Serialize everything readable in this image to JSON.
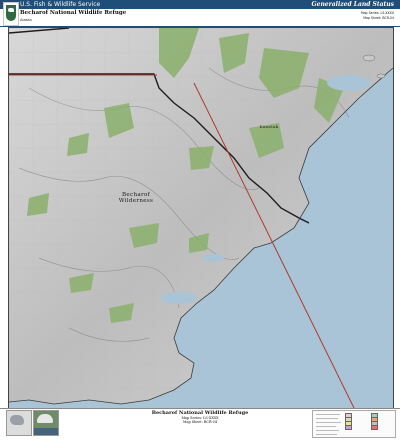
{
  "header": {
    "agency": "U.S. Fish & Wildlife Service",
    "title": "Becharof National Wildlife Refuge",
    "state": "Alaska",
    "status_title": "Generalized Land Status",
    "map_series": "Map Series: LS-XXXX",
    "map_sheet": "Map Sheet: BCR-04"
  },
  "map": {
    "labels": {
      "wilderness": "Becharof Wilderness",
      "place": "Kanatak"
    },
    "colors": {
      "refuge_land": "#8ab06c",
      "water": "#a8c4d6",
      "boundary": "#1d1d1d",
      "survey_line": "#b03a2e",
      "terrain": "#cfcfcf"
    }
  },
  "footer": {
    "title": "Becharof National Wildlife Refuge",
    "series": "Map Series: LS-XXXX",
    "sheet": "Map Sheet: BCR-04"
  },
  "legend": {
    "colors": [
      "#f3c1d0",
      "#cfe4a3",
      "#f6e08a",
      "#c8a0d0",
      "#9fd3a6",
      "#f5a36a",
      "#bfbfbf",
      "#e86f6f"
    ]
  }
}
